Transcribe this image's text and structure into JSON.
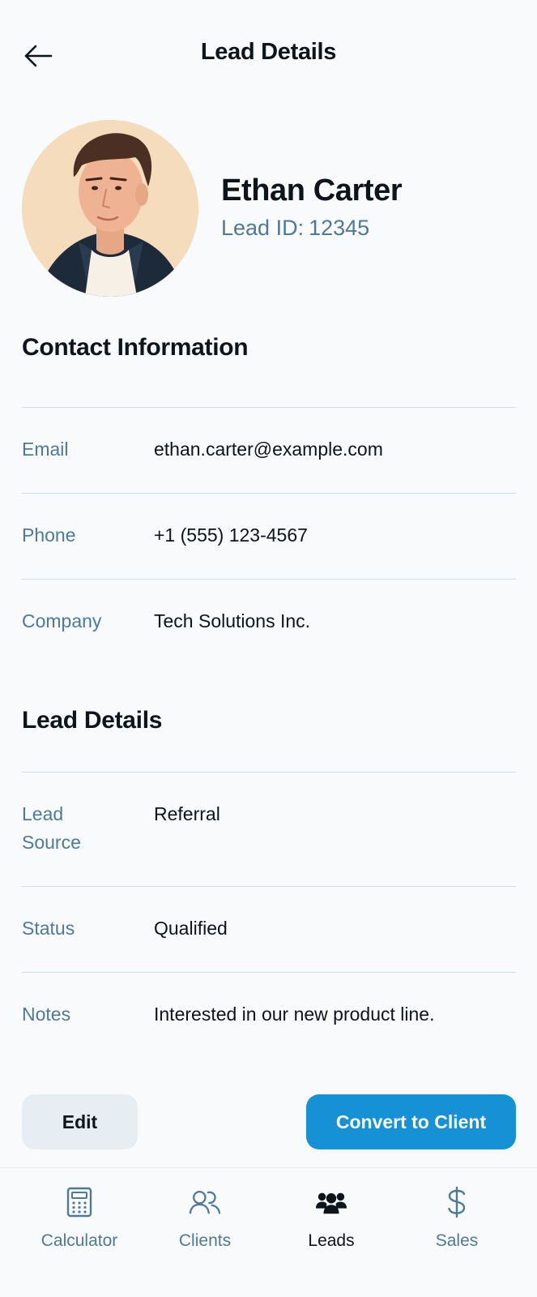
{
  "header": {
    "title": "Lead Details",
    "back_icon": "arrow-left-icon"
  },
  "profile": {
    "name": "Ethan Carter",
    "lead_id_label": "Lead ID:",
    "lead_id_value": "12345"
  },
  "contact_section": {
    "title": "Contact Information",
    "rows": [
      {
        "label": "Email",
        "value": "ethan.carter@example.com"
      },
      {
        "label": "Phone",
        "value": "+1 (555) 123-4567"
      },
      {
        "label": "Company",
        "value": "Tech Solutions Inc."
      }
    ]
  },
  "lead_section": {
    "title": "Lead Details",
    "rows": [
      {
        "label": "Lead Source",
        "value": "Referral"
      },
      {
        "label": "Status",
        "value": "Qualified"
      },
      {
        "label": "Notes",
        "value": "Interested in our new product line."
      }
    ]
  },
  "actions": {
    "edit_label": "Edit",
    "convert_label": "Convert to Client"
  },
  "nav": {
    "items": [
      {
        "label": "Calculator",
        "icon": "calculator-icon",
        "active": false
      },
      {
        "label": "Clients",
        "icon": "users-icon",
        "active": false
      },
      {
        "label": "Leads",
        "icon": "users-filled-icon",
        "active": true
      },
      {
        "label": "Sales",
        "icon": "dollar-icon",
        "active": false
      }
    ]
  },
  "colors": {
    "primary": "#1791d6",
    "secondary_text": "#4e7a97",
    "text": "#0e141b",
    "divider": "#cfdde7",
    "background": "#f8fafc",
    "edit_bg": "#e7eef3"
  }
}
